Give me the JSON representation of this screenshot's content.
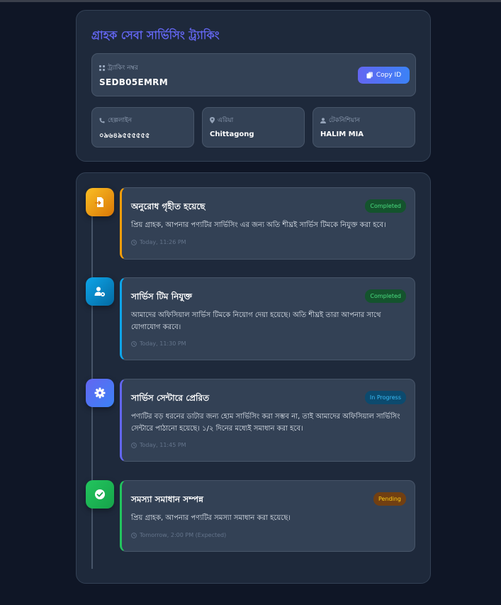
{
  "header": {
    "title": "গ্রাহক সেবা সার্ভিসিং ট্র্যাকিং",
    "tracking_label": "ট্র্যাকিং নম্বর",
    "tracking_value": "SEDB05EMRM",
    "copy_label": "Copy ID"
  },
  "info": [
    {
      "label": "হেল্পলাইন",
      "value": "০৯৬৪৯৫৫৫৫৫৫",
      "icon": "phone-icon"
    },
    {
      "label": "এরিয়া",
      "value": "Chittagong",
      "icon": "map-pin-icon"
    },
    {
      "label": "টেকনিশিয়ান",
      "value": "HALIM MIA",
      "icon": "user-icon"
    }
  ],
  "steps": [
    {
      "title": "অনুরোধ গৃহীত হয়েছে",
      "status": "Completed",
      "text": "প্রিয় গ্রাহক, আপনার পণ্যটির সার্ভিসিং এর জন্য অতি শীঘ্রই সার্ভিস টিমকে নিযুক্ত করা হবে।",
      "time": "Today, 11:26 PM",
      "icon": "file-import-icon",
      "color": "#f59e0b"
    },
    {
      "title": "সার্ভিস টিম নিযুক্ত",
      "status": "Completed",
      "text": "আমাদের অফিসিয়াল সার্ভিস টিমকে নিয়োগ দেয়া হয়েছে। অতি শীঘ্রই তারা আপনার সাথে যোগাযোগ করবে।",
      "time": "Today, 11:30 PM",
      "icon": "user-gear-icon",
      "color": "#0ea5e9"
    },
    {
      "title": "সার্ভিস সেন্টারে প্রেরিত",
      "status": "In Progress",
      "text": "পণ্যটির বড় ধরনের ডাটার জন্য হোম সার্ভিসিং করা সম্ভব না, তাই আমাদের অফিসিয়াল সার্ভিসিং সেন্টারে পাঠানো হয়েছে। ১/২ দিনের মধ্যেই সমাধান করা হবে।",
      "time": "Today, 11:45 PM",
      "icon": "gear-icon",
      "color": "#6366f1"
    },
    {
      "title": "সমস্যা সমাধান সম্পন্ন",
      "status": "Pending",
      "text": "প্রিয় গ্রাহক, আপনার পণ্যটির সমস্যা সমাধান করা হয়েছে।",
      "time": "Tomorrow, 2:00 PM (Expected)",
      "icon": "check-circle-icon",
      "color": "#22c55e"
    }
  ],
  "colors": {
    "accent": "#6366f1",
    "completed_bg": "#14532d",
    "completed_text": "#4ade80",
    "progress_bg": "#0c4a6e",
    "progress_text": "#38bdf8",
    "pending_bg": "#713f12",
    "pending_text": "#facc15"
  }
}
